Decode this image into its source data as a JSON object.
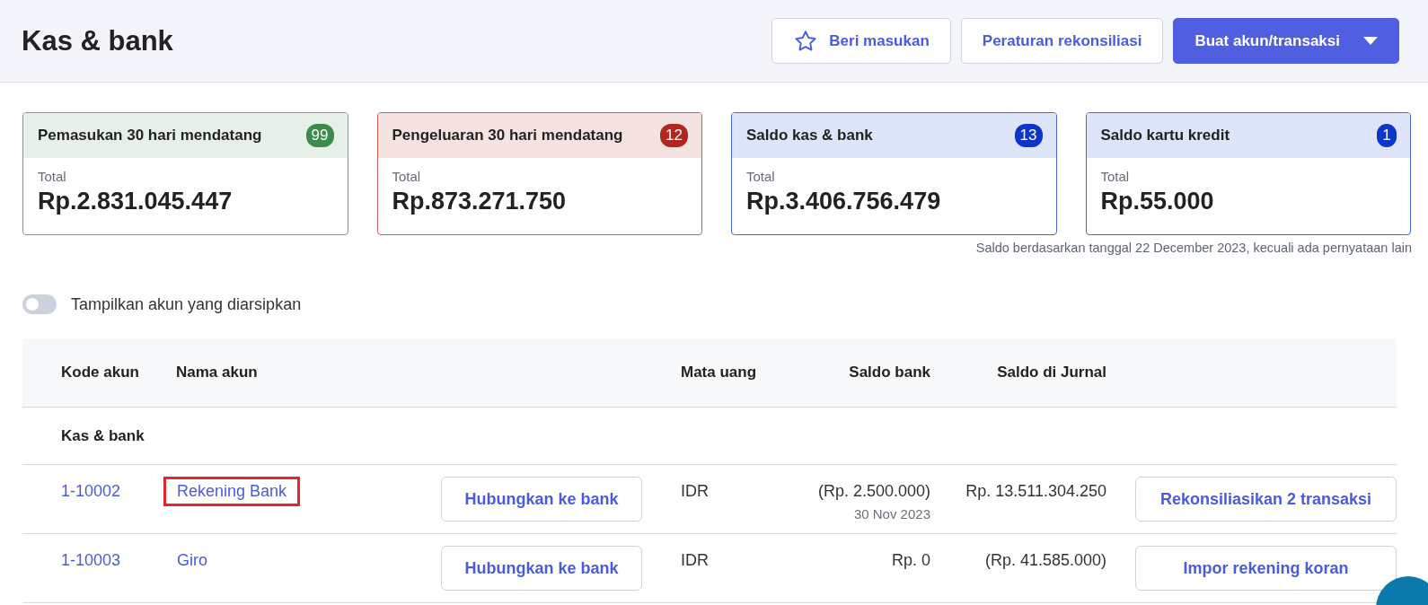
{
  "header": {
    "title": "Kas & bank",
    "buttons": [
      {
        "kind": "feedback",
        "label": "Beri masukan"
      },
      {
        "kind": "outline",
        "label": "Peraturan rekonsiliasi"
      },
      {
        "kind": "primary",
        "label": "Buat akun/transaksi"
      }
    ]
  },
  "cards": [
    {
      "title": "Pemasukan 30 hari mendatang",
      "count": "99",
      "color": "#3b8c4c",
      "label": "Total",
      "amount": "Rp.2.831.045.447"
    },
    {
      "title": "Pengeluaran 30 hari mendatang",
      "count": "12",
      "color": "#b0271f",
      "label": "Total",
      "amount": "Rp.873.271.750"
    },
    {
      "title": "Saldo kas & bank",
      "count": "13",
      "color": "#0b36c9",
      "label": "Total",
      "amount": "Rp.3.406.756.479"
    },
    {
      "title": "Saldo kartu kredit",
      "count": "1",
      "color": "#0b36c9",
      "label": "Total",
      "amount": "Rp.55.000"
    }
  ],
  "balance_note": "Saldo berdasarkan tanggal 22 December 2023, kecuali ada pernyataan lain",
  "archive_toggle": {
    "label": "Tampilkan akun yang diarsipkan",
    "on": false
  },
  "table": {
    "columns": [
      "Kode akun",
      "Nama akun",
      "Mata uang",
      "Saldo bank",
      "Saldo di Jurnal"
    ],
    "group": "Kas & bank",
    "rows": [
      {
        "code": "1-10002",
        "name": "Rekening Bank",
        "highlighted": true,
        "connect": "Hubungkan ke bank",
        "currency": "IDR",
        "bank_balance": "(Rp. 2.500.000)",
        "bank_date": "30 Nov 2023",
        "journal_balance": "Rp. 13.511.304.250",
        "action": "Rekonsiliasikan 2 transaksi"
      },
      {
        "code": "1-10003",
        "name": "Giro",
        "highlighted": false,
        "connect": "Hubungkan ke bank",
        "currency": "IDR",
        "bank_balance": "Rp. 0",
        "journal_balance": "(Rp. 41.585.000)",
        "action": "Impor rekening koran"
      }
    ]
  }
}
